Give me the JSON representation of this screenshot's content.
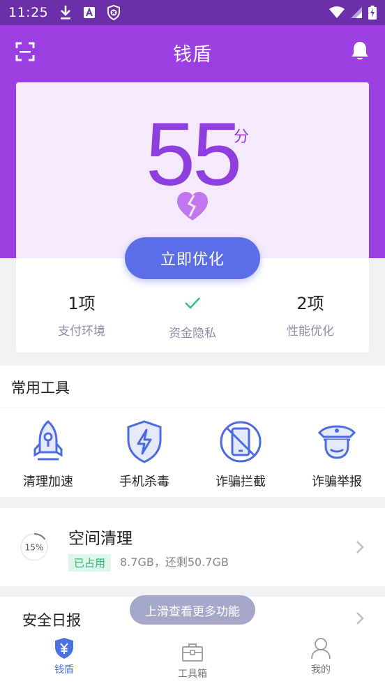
{
  "status_bar": {
    "time": "11:25",
    "icons_left": [
      "download-icon",
      "a-badge-icon",
      "shield-x-icon"
    ],
    "icons_right": [
      "wifi-icon",
      "signal-icon",
      "battery-charging-icon"
    ]
  },
  "header": {
    "title": "钱盾",
    "left_icon": "scan-icon",
    "right_icon": "bell-icon",
    "bg_color": "#9b3ee2"
  },
  "score": {
    "value": "55",
    "unit": "分",
    "icon": "broken-heart-icon",
    "button_label": "立即优化",
    "accent": "#8f3ee0",
    "button_color": "#5b6ee8"
  },
  "metrics": [
    {
      "value": "1项",
      "label": "支付环境"
    },
    {
      "value": "",
      "icon": "check-icon",
      "label": "资金隐私"
    },
    {
      "value": "2项",
      "label": "性能优化"
    }
  ],
  "tools": {
    "title": "常用工具",
    "items": [
      {
        "label": "清理加速",
        "icon": "rocket-icon"
      },
      {
        "label": "手机杀毒",
        "icon": "shield-bolt-icon"
      },
      {
        "label": "诈骗拦截",
        "icon": "phone-block-icon"
      },
      {
        "label": "诈骗举报",
        "icon": "police-icon"
      }
    ]
  },
  "space_clean": {
    "title": "空间清理",
    "percent": 15,
    "percent_label": "15%",
    "badge": "已占用",
    "detail": "8.7GB，还剩50.7GB"
  },
  "daily_report": {
    "title": "安全日报"
  },
  "hint": "上滑查看更多功能",
  "bottom_nav": [
    {
      "label": "钱盾",
      "icon": "shield-yen-icon",
      "active": true
    },
    {
      "label": "工具箱",
      "icon": "toolbox-icon",
      "active": false
    },
    {
      "label": "我的",
      "icon": "user-icon",
      "active": false
    }
  ]
}
